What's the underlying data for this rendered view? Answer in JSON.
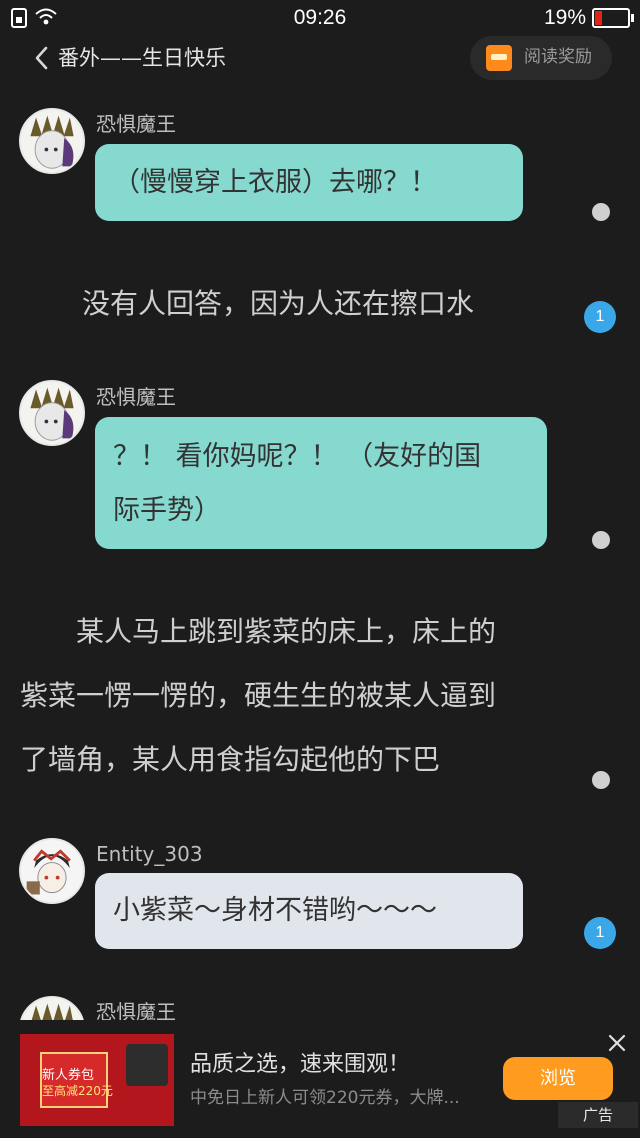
{
  "status_bar": {
    "time": "09:26",
    "battery": "19%"
  },
  "header": {
    "title": "番外——生日快乐",
    "reward_label": "阅读奖励"
  },
  "messages": [
    {
      "name": "恐惧魔王",
      "text": "（慢慢穿上衣服）去哪？！"
    },
    {
      "narration": "没有人回答，因为人还在擦口水",
      "badge": "1"
    },
    {
      "name": "恐惧魔王",
      "line1": "？！ 看你妈呢？！ （友好的国",
      "line2": "际手势）"
    },
    {
      "line1": "　　某人马上跳到紫菜的床上，床上的",
      "line2": "紫菜一愣一愣的，硬生生的被某人逼到",
      "line3": "了墙角，某人用食指勾起他的下巴"
    },
    {
      "name": "Entity_303",
      "text": "小紫菜～身材不错哟～～～",
      "badge": "1"
    },
    {
      "name": "恐惧魔王"
    }
  ],
  "ad": {
    "image_line1": "新人券包",
    "image_line2": "至高减220元",
    "title": "品质之选，速来围观！",
    "description": "中免日上新人可领220元券，大牌...",
    "button": "浏览",
    "tag": "广告"
  }
}
